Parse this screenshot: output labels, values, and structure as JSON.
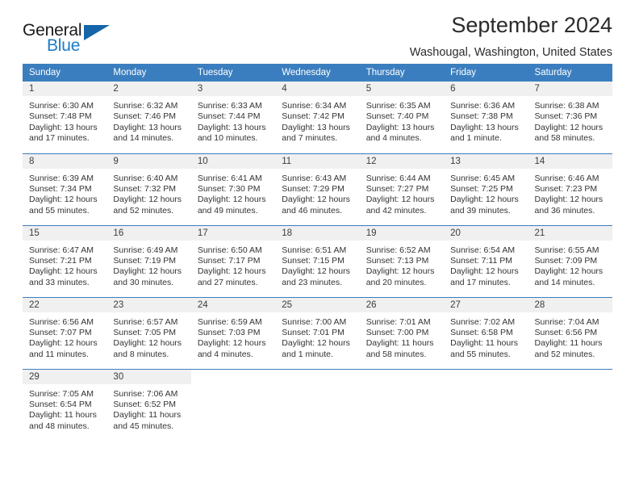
{
  "brand": {
    "word_one": "General",
    "word_two": "Blue",
    "accent_color": "#1c7cc4",
    "triangle_color": "#1565a8",
    "triangle_icon": "triangle-right-icon"
  },
  "header": {
    "title": "September 2024",
    "location": "Washougal, Washington, United States"
  },
  "calendar": {
    "header_color": "#3b7ebf",
    "daynum_background": "#f0f0f0",
    "weekdays": [
      "Sunday",
      "Monday",
      "Tuesday",
      "Wednesday",
      "Thursday",
      "Friday",
      "Saturday"
    ],
    "labels": {
      "sunrise": "Sunrise:",
      "sunset": "Sunset:",
      "daylight": "Daylight:"
    },
    "weeks": [
      [
        {
          "day": "1",
          "sunrise": "Sunrise: 6:30 AM",
          "sunset": "Sunset: 7:48 PM",
          "daylight_line1": "Daylight: 13 hours",
          "daylight_line2": "and 17 minutes."
        },
        {
          "day": "2",
          "sunrise": "Sunrise: 6:32 AM",
          "sunset": "Sunset: 7:46 PM",
          "daylight_line1": "Daylight: 13 hours",
          "daylight_line2": "and 14 minutes."
        },
        {
          "day": "3",
          "sunrise": "Sunrise: 6:33 AM",
          "sunset": "Sunset: 7:44 PM",
          "daylight_line1": "Daylight: 13 hours",
          "daylight_line2": "and 10 minutes."
        },
        {
          "day": "4",
          "sunrise": "Sunrise: 6:34 AM",
          "sunset": "Sunset: 7:42 PM",
          "daylight_line1": "Daylight: 13 hours",
          "daylight_line2": "and 7 minutes."
        },
        {
          "day": "5",
          "sunrise": "Sunrise: 6:35 AM",
          "sunset": "Sunset: 7:40 PM",
          "daylight_line1": "Daylight: 13 hours",
          "daylight_line2": "and 4 minutes."
        },
        {
          "day": "6",
          "sunrise": "Sunrise: 6:36 AM",
          "sunset": "Sunset: 7:38 PM",
          "daylight_line1": "Daylight: 13 hours",
          "daylight_line2": "and 1 minute."
        },
        {
          "day": "7",
          "sunrise": "Sunrise: 6:38 AM",
          "sunset": "Sunset: 7:36 PM",
          "daylight_line1": "Daylight: 12 hours",
          "daylight_line2": "and 58 minutes."
        }
      ],
      [
        {
          "day": "8",
          "sunrise": "Sunrise: 6:39 AM",
          "sunset": "Sunset: 7:34 PM",
          "daylight_line1": "Daylight: 12 hours",
          "daylight_line2": "and 55 minutes."
        },
        {
          "day": "9",
          "sunrise": "Sunrise: 6:40 AM",
          "sunset": "Sunset: 7:32 PM",
          "daylight_line1": "Daylight: 12 hours",
          "daylight_line2": "and 52 minutes."
        },
        {
          "day": "10",
          "sunrise": "Sunrise: 6:41 AM",
          "sunset": "Sunset: 7:30 PM",
          "daylight_line1": "Daylight: 12 hours",
          "daylight_line2": "and 49 minutes."
        },
        {
          "day": "11",
          "sunrise": "Sunrise: 6:43 AM",
          "sunset": "Sunset: 7:29 PM",
          "daylight_line1": "Daylight: 12 hours",
          "daylight_line2": "and 46 minutes."
        },
        {
          "day": "12",
          "sunrise": "Sunrise: 6:44 AM",
          "sunset": "Sunset: 7:27 PM",
          "daylight_line1": "Daylight: 12 hours",
          "daylight_line2": "and 42 minutes."
        },
        {
          "day": "13",
          "sunrise": "Sunrise: 6:45 AM",
          "sunset": "Sunset: 7:25 PM",
          "daylight_line1": "Daylight: 12 hours",
          "daylight_line2": "and 39 minutes."
        },
        {
          "day": "14",
          "sunrise": "Sunrise: 6:46 AM",
          "sunset": "Sunset: 7:23 PM",
          "daylight_line1": "Daylight: 12 hours",
          "daylight_line2": "and 36 minutes."
        }
      ],
      [
        {
          "day": "15",
          "sunrise": "Sunrise: 6:47 AM",
          "sunset": "Sunset: 7:21 PM",
          "daylight_line1": "Daylight: 12 hours",
          "daylight_line2": "and 33 minutes."
        },
        {
          "day": "16",
          "sunrise": "Sunrise: 6:49 AM",
          "sunset": "Sunset: 7:19 PM",
          "daylight_line1": "Daylight: 12 hours",
          "daylight_line2": "and 30 minutes."
        },
        {
          "day": "17",
          "sunrise": "Sunrise: 6:50 AM",
          "sunset": "Sunset: 7:17 PM",
          "daylight_line1": "Daylight: 12 hours",
          "daylight_line2": "and 27 minutes."
        },
        {
          "day": "18",
          "sunrise": "Sunrise: 6:51 AM",
          "sunset": "Sunset: 7:15 PM",
          "daylight_line1": "Daylight: 12 hours",
          "daylight_line2": "and 23 minutes."
        },
        {
          "day": "19",
          "sunrise": "Sunrise: 6:52 AM",
          "sunset": "Sunset: 7:13 PM",
          "daylight_line1": "Daylight: 12 hours",
          "daylight_line2": "and 20 minutes."
        },
        {
          "day": "20",
          "sunrise": "Sunrise: 6:54 AM",
          "sunset": "Sunset: 7:11 PM",
          "daylight_line1": "Daylight: 12 hours",
          "daylight_line2": "and 17 minutes."
        },
        {
          "day": "21",
          "sunrise": "Sunrise: 6:55 AM",
          "sunset": "Sunset: 7:09 PM",
          "daylight_line1": "Daylight: 12 hours",
          "daylight_line2": "and 14 minutes."
        }
      ],
      [
        {
          "day": "22",
          "sunrise": "Sunrise: 6:56 AM",
          "sunset": "Sunset: 7:07 PM",
          "daylight_line1": "Daylight: 12 hours",
          "daylight_line2": "and 11 minutes."
        },
        {
          "day": "23",
          "sunrise": "Sunrise: 6:57 AM",
          "sunset": "Sunset: 7:05 PM",
          "daylight_line1": "Daylight: 12 hours",
          "daylight_line2": "and 8 minutes."
        },
        {
          "day": "24",
          "sunrise": "Sunrise: 6:59 AM",
          "sunset": "Sunset: 7:03 PM",
          "daylight_line1": "Daylight: 12 hours",
          "daylight_line2": "and 4 minutes."
        },
        {
          "day": "25",
          "sunrise": "Sunrise: 7:00 AM",
          "sunset": "Sunset: 7:01 PM",
          "daylight_line1": "Daylight: 12 hours",
          "daylight_line2": "and 1 minute."
        },
        {
          "day": "26",
          "sunrise": "Sunrise: 7:01 AM",
          "sunset": "Sunset: 7:00 PM",
          "daylight_line1": "Daylight: 11 hours",
          "daylight_line2": "and 58 minutes."
        },
        {
          "day": "27",
          "sunrise": "Sunrise: 7:02 AM",
          "sunset": "Sunset: 6:58 PM",
          "daylight_line1": "Daylight: 11 hours",
          "daylight_line2": "and 55 minutes."
        },
        {
          "day": "28",
          "sunrise": "Sunrise: 7:04 AM",
          "sunset": "Sunset: 6:56 PM",
          "daylight_line1": "Daylight: 11 hours",
          "daylight_line2": "and 52 minutes."
        }
      ],
      [
        {
          "day": "29",
          "sunrise": "Sunrise: 7:05 AM",
          "sunset": "Sunset: 6:54 PM",
          "daylight_line1": "Daylight: 11 hours",
          "daylight_line2": "and 48 minutes."
        },
        {
          "day": "30",
          "sunrise": "Sunrise: 7:06 AM",
          "sunset": "Sunset: 6:52 PM",
          "daylight_line1": "Daylight: 11 hours",
          "daylight_line2": "and 45 minutes."
        },
        {
          "day": "",
          "sunrise": "",
          "sunset": "",
          "daylight_line1": "",
          "daylight_line2": ""
        },
        {
          "day": "",
          "sunrise": "",
          "sunset": "",
          "daylight_line1": "",
          "daylight_line2": ""
        },
        {
          "day": "",
          "sunrise": "",
          "sunset": "",
          "daylight_line1": "",
          "daylight_line2": ""
        },
        {
          "day": "",
          "sunrise": "",
          "sunset": "",
          "daylight_line1": "",
          "daylight_line2": ""
        },
        {
          "day": "",
          "sunrise": "",
          "sunset": "",
          "daylight_line1": "",
          "daylight_line2": ""
        }
      ]
    ]
  }
}
